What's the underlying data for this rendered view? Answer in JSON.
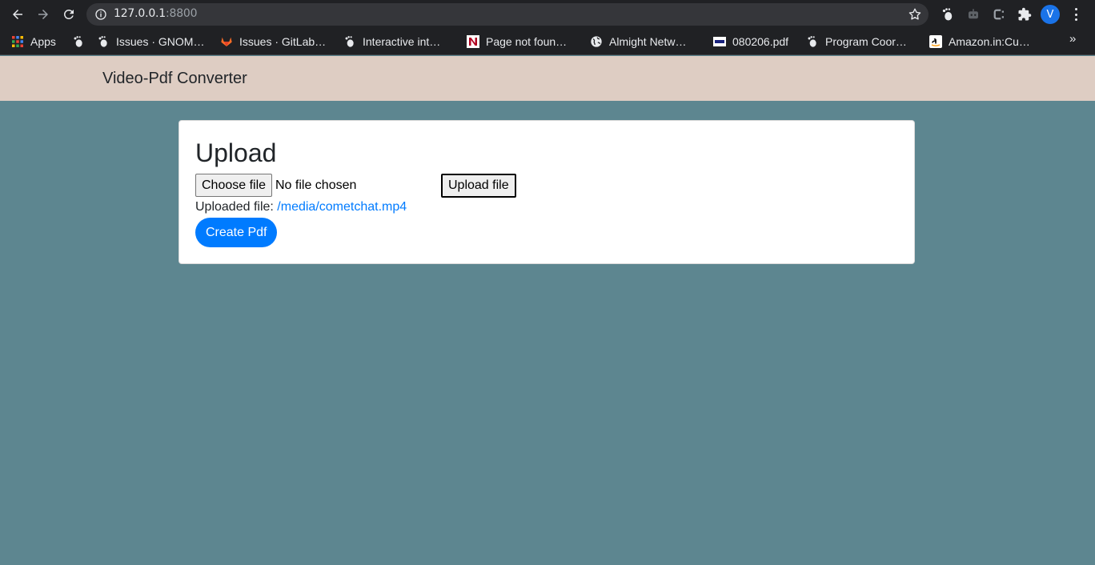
{
  "browser": {
    "url_host": "127.0.0.1",
    "url_port": ":8800",
    "avatar_letter": "V",
    "bookmarks": [
      {
        "label": "Apps",
        "icon": "apps-grid-icon"
      },
      {
        "label": "",
        "icon": "gnome-foot-icon"
      },
      {
        "label": "Issues · GNOM…",
        "icon": "gnome-foot-icon"
      },
      {
        "label": "Issues · GitLab…",
        "icon": "gitlab-icon"
      },
      {
        "label": "Interactive int…",
        "icon": "gnome-foot-icon"
      },
      {
        "label": "Page not foun…",
        "icon": "n-logo-icon"
      },
      {
        "label": "Almight Netw…",
        "icon": "globe-icon"
      },
      {
        "label": "080206.pdf",
        "icon": "nec-icon"
      },
      {
        "label": "Program Coor…",
        "icon": "gnome-foot-icon"
      },
      {
        "label": "Amazon.in:Cu…",
        "icon": "amazon-icon"
      }
    ],
    "more_bookmarks": "»"
  },
  "page": {
    "brand": "Video-Pdf Converter",
    "card_title": "Upload",
    "choose_file_label": "Choose file",
    "file_status": "No file chosen",
    "upload_button_label": "Upload file",
    "uploaded_prefix": "Uploaded file:",
    "uploaded_link": "/media/cometchat.mp4",
    "create_pdf_label": "Create Pdf"
  },
  "colors": {
    "page_background": "#5d8690",
    "navbar_background": "#decdc3",
    "primary": "#007bff"
  }
}
